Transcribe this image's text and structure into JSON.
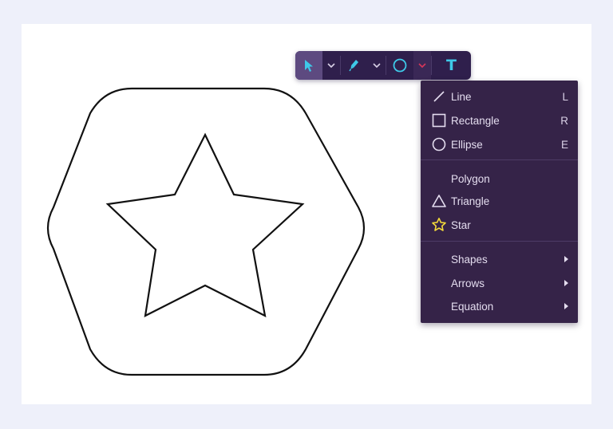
{
  "toolbar": {
    "tools": [
      {
        "name": "select-tool",
        "icon": "cursor-arrow-icon",
        "active": true
      },
      {
        "name": "pen-tool",
        "icon": "pen-icon",
        "active": false
      },
      {
        "name": "shape-tool",
        "icon": "circle-icon",
        "active": false
      },
      {
        "name": "text-tool",
        "icon": "text-icon",
        "label": "T",
        "active": false
      }
    ],
    "accent": "#3ec9e8"
  },
  "shape_menu": {
    "groups": [
      [
        {
          "label": "Line",
          "shortcut": "L",
          "icon": "line-icon"
        },
        {
          "label": "Rectangle",
          "shortcut": "R",
          "icon": "square-icon"
        },
        {
          "label": "Ellipse",
          "shortcut": "E",
          "icon": "circle-icon"
        }
      ],
      [
        {
          "label": "Polygon",
          "shortcut": "",
          "icon": ""
        },
        {
          "label": "Triangle",
          "shortcut": "",
          "icon": "triangle-icon"
        },
        {
          "label": "Star",
          "shortcut": "",
          "icon": "star-icon"
        }
      ],
      [
        {
          "label": "Shapes",
          "submenu": true
        },
        {
          "label": "Arrows",
          "submenu": true
        },
        {
          "label": "Equation",
          "submenu": true
        }
      ]
    ],
    "star_icon_color": "#f2d83a"
  },
  "canvas": {
    "shapes": [
      "hexagon",
      "star"
    ]
  }
}
